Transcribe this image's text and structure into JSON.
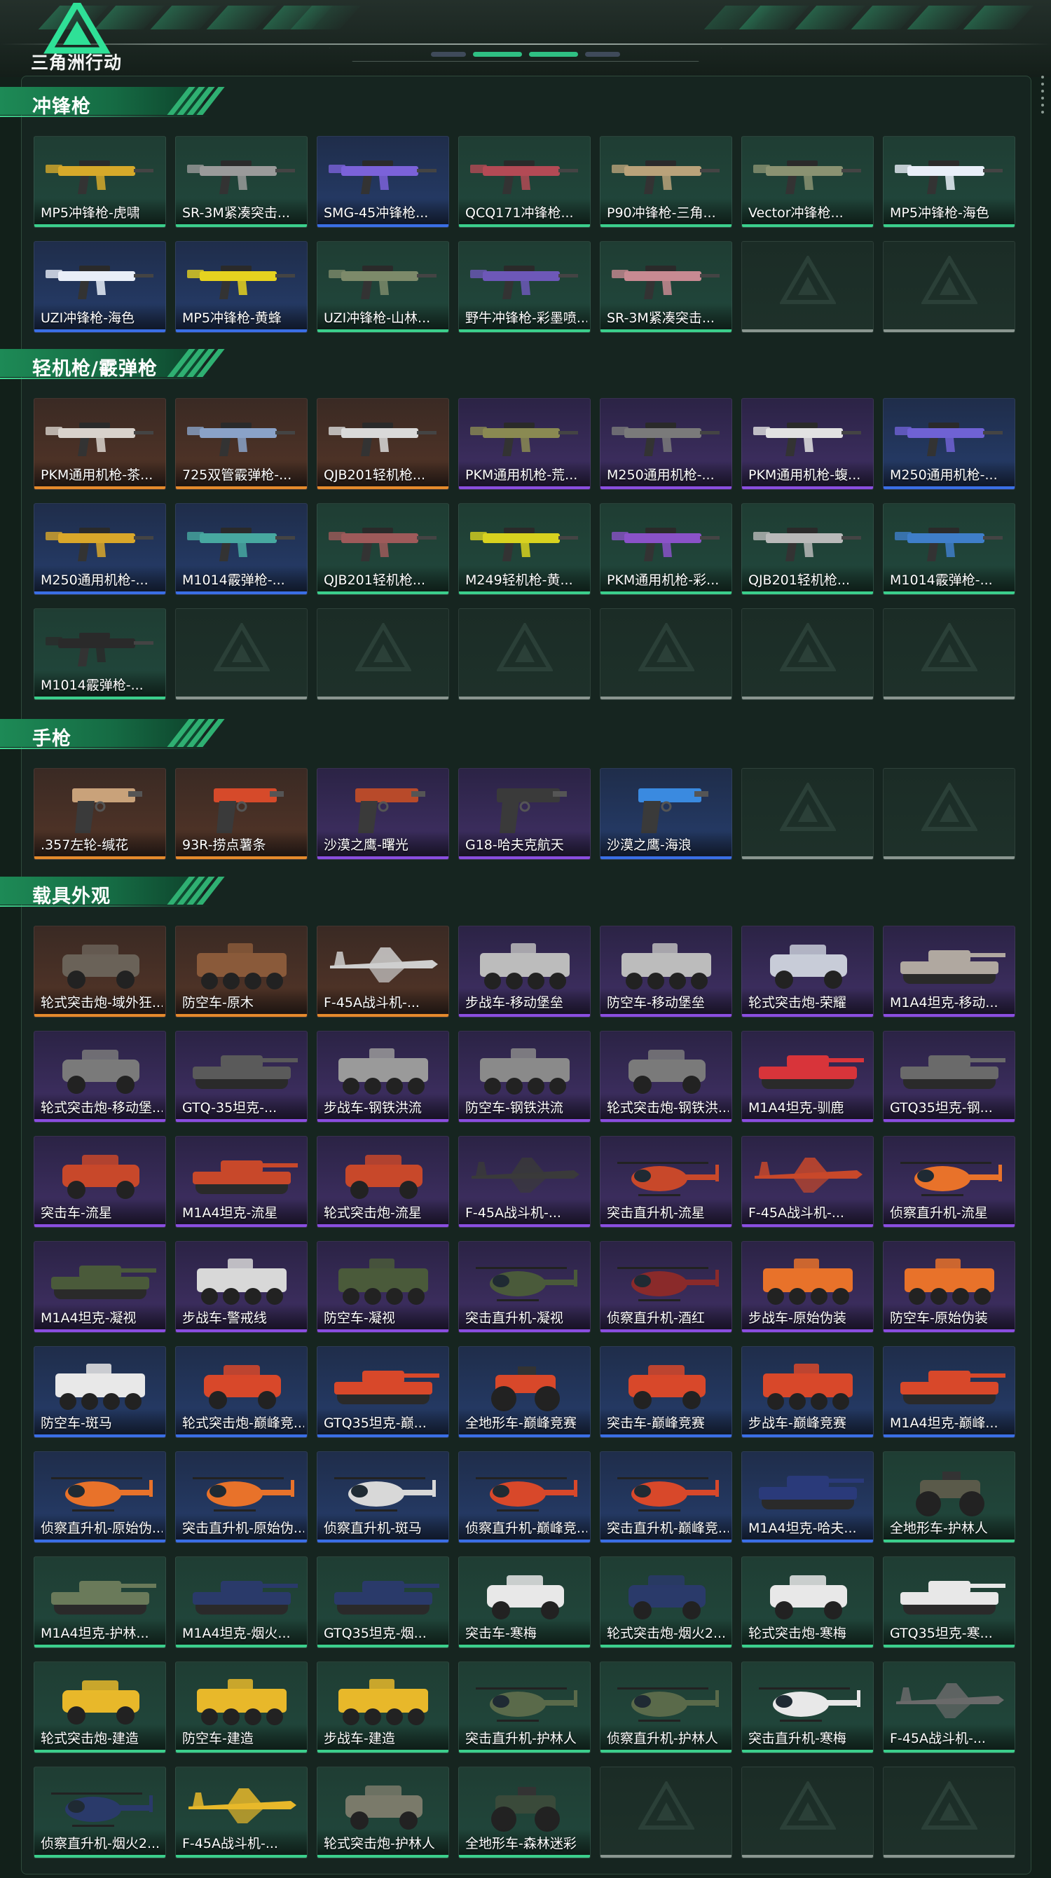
{
  "app": {
    "logo_text": "三角洲行动",
    "logo_icon": "delta-triangle-logo"
  },
  "colors": {
    "background": "#12201a",
    "accent_green": "#3bcf8c",
    "rarity_green": "#3bcf8c",
    "rarity_blue": "#3a6fe6",
    "rarity_purple": "#8a4ee0",
    "rarity_orange": "#e58a2c",
    "empty_slot": "#8a9690"
  },
  "sections": [
    {
      "title": "冲锋枪",
      "kind": "gun",
      "items": [
        {
          "name": "MP5冲锋枪-虎啸",
          "rarity": "green",
          "color": "#d6a92a"
        },
        {
          "name": "SR-3M紧凑突击...",
          "rarity": "green",
          "color": "#9a9a9a"
        },
        {
          "name": "SMG-45冲锋枪...",
          "rarity": "blue",
          "color": "#7b62d9"
        },
        {
          "name": "QCQ171冲锋枪...",
          "rarity": "green",
          "color": "#b34a55"
        },
        {
          "name": "P90冲锋枪-三角...",
          "rarity": "green",
          "color": "#b9a27a"
        },
        {
          "name": "Vector冲锋枪...",
          "rarity": "green",
          "color": "#8a9272"
        },
        {
          "name": "MP5冲锋枪-海色",
          "rarity": "green",
          "color": "#e8eef8"
        },
        {
          "name": "UZI冲锋枪-海色",
          "rarity": "blue",
          "color": "#e8eef8"
        },
        {
          "name": "MP5冲锋枪-黄蜂",
          "rarity": "blue",
          "color": "#e6d21f"
        },
        {
          "name": "UZI冲锋枪-山林...",
          "rarity": "green",
          "color": "#7d8a6a"
        },
        {
          "name": "野牛冲锋枪-彩墨喷...",
          "rarity": "green",
          "color": "#6d58b8"
        },
        {
          "name": "SR-3M紧凑突击...",
          "rarity": "green",
          "color": "#c88a92"
        },
        {
          "name": "",
          "rarity": "empty"
        },
        {
          "name": "",
          "rarity": "empty"
        }
      ]
    },
    {
      "title": "轻机枪/霰弹枪",
      "kind": "gun",
      "items": [
        {
          "name": "PKM通用机枪-茶...",
          "rarity": "orange",
          "color": "#d8d2cc"
        },
        {
          "name": "725双管霰弹枪-...",
          "rarity": "orange",
          "color": "#8aa2c8"
        },
        {
          "name": "QJB201轻机枪...",
          "rarity": "orange",
          "color": "#d9d9d9"
        },
        {
          "name": "PKM通用机枪-荒...",
          "rarity": "purple",
          "color": "#8a8a52"
        },
        {
          "name": "M250通用机枪-...",
          "rarity": "purple",
          "color": "#7a7a7a"
        },
        {
          "name": "PKM通用机枪-蝮...",
          "rarity": "purple",
          "color": "#e2e2e2"
        },
        {
          "name": "M250通用机枪-...",
          "rarity": "blue",
          "color": "#6f62d4"
        },
        {
          "name": "M250通用机枪-...",
          "rarity": "blue",
          "color": "#d9a72a"
        },
        {
          "name": "M1014霰弹枪-...",
          "rarity": "blue",
          "color": "#47a8a0"
        },
        {
          "name": "QJB201轻机枪...",
          "rarity": "green",
          "color": "#9e5a5a"
        },
        {
          "name": "M249轻机枪-黄...",
          "rarity": "green",
          "color": "#d8d21f"
        },
        {
          "name": "PKM通用机枪-彩...",
          "rarity": "green",
          "color": "#8a52c8"
        },
        {
          "name": "QJB201轻机枪...",
          "rarity": "green",
          "color": "#b9b9b9"
        },
        {
          "name": "M1014霰弹枪-...",
          "rarity": "green",
          "color": "#3f7ec9"
        },
        {
          "name": "M1014霰弹枪-...",
          "rarity": "green",
          "color": "#2a2a2a"
        },
        {
          "name": "",
          "rarity": "empty"
        },
        {
          "name": "",
          "rarity": "empty"
        },
        {
          "name": "",
          "rarity": "empty"
        },
        {
          "name": "",
          "rarity": "empty"
        },
        {
          "name": "",
          "rarity": "empty"
        },
        {
          "name": "",
          "rarity": "empty"
        }
      ]
    },
    {
      "title": "手枪",
      "kind": "pistol",
      "items": [
        {
          "name": ".357左轮-缄花",
          "rarity": "orange",
          "color": "#c9a27a"
        },
        {
          "name": "93R-捞点薯条",
          "rarity": "orange",
          "color": "#d64a2a"
        },
        {
          "name": "沙漠之鹰-曙光",
          "rarity": "purple",
          "color": "#b84a2a"
        },
        {
          "name": "G18-哈夫克航天",
          "rarity": "purple",
          "color": "#3a3a3a"
        },
        {
          "name": "沙漠之鹰-海浪",
          "rarity": "blue",
          "color": "#3a8ae0"
        },
        {
          "name": "",
          "rarity": "empty"
        },
        {
          "name": "",
          "rarity": "empty"
        }
      ]
    },
    {
      "title": "载具外观",
      "kind": "vehicle",
      "items": [
        {
          "name": "轮式突击炮-域外狂...",
          "rarity": "orange",
          "color": "#6a6258",
          "shape": "car"
        },
        {
          "name": "防空车-原木",
          "rarity": "orange",
          "color": "#8a5a3a",
          "shape": "apc"
        },
        {
          "name": "F-45A战斗机-...",
          "rarity": "orange",
          "color": "#cfcfcf",
          "shape": "jet"
        },
        {
          "name": "步战车-移动堡垒",
          "rarity": "purple",
          "color": "#bcbcbc",
          "shape": "apc"
        },
        {
          "name": "防空车-移动堡垒",
          "rarity": "purple",
          "color": "#bcbcbc",
          "shape": "apc"
        },
        {
          "name": "轮式突击炮-荣耀",
          "rarity": "purple",
          "color": "#c8ccd8",
          "shape": "car"
        },
        {
          "name": "M1A4坦克-移动...",
          "rarity": "purple",
          "color": "#b0a8a0",
          "shape": "tank"
        },
        {
          "name": "轮式突击炮-移动堡...",
          "rarity": "purple",
          "color": "#7a7a7a",
          "shape": "car"
        },
        {
          "name": "GTQ-35坦克-...",
          "rarity": "purple",
          "color": "#5a5a5a",
          "shape": "tank"
        },
        {
          "name": "步战车-钢铁洪流",
          "rarity": "purple",
          "color": "#9a9a9a",
          "shape": "apc"
        },
        {
          "name": "防空车-钢铁洪流",
          "rarity": "purple",
          "color": "#8a8a8a",
          "shape": "apc"
        },
        {
          "name": "轮式突击炮-钢铁洪...",
          "rarity": "purple",
          "color": "#7a7a7a",
          "shape": "car"
        },
        {
          "name": "M1A4坦克-驯鹿",
          "rarity": "purple",
          "color": "#d8343a",
          "shape": "tank"
        },
        {
          "name": "GTQ35坦克-钢...",
          "rarity": "purple",
          "color": "#6a6a6a",
          "shape": "tank"
        },
        {
          "name": "突击车-流星",
          "rarity": "purple",
          "color": "#c8482a",
          "shape": "car"
        },
        {
          "name": "M1A4坦克-流星",
          "rarity": "purple",
          "color": "#c8482a",
          "shape": "tank"
        },
        {
          "name": "轮式突击炮-流星",
          "rarity": "purple",
          "color": "#c8482a",
          "shape": "car"
        },
        {
          "name": "F-45A战斗机-...",
          "rarity": "purple",
          "color": "#3a3a3a",
          "shape": "jet"
        },
        {
          "name": "突击直升机-流星",
          "rarity": "purple",
          "color": "#c8482a",
          "shape": "heli"
        },
        {
          "name": "F-45A战斗机-...",
          "rarity": "purple",
          "color": "#c8482a",
          "shape": "jet"
        },
        {
          "name": "侦察直升机-流星",
          "rarity": "purple",
          "color": "#e8722a",
          "shape": "heli"
        },
        {
          "name": "M1A4坦克-凝视",
          "rarity": "purple",
          "color": "#4a5a3a",
          "shape": "tank"
        },
        {
          "name": "步战车-警戒线",
          "rarity": "purple",
          "color": "#d8d8d8",
          "shape": "apc"
        },
        {
          "name": "防空车-凝视",
          "rarity": "purple",
          "color": "#4a5a3a",
          "shape": "apc"
        },
        {
          "name": "突击直升机-凝视",
          "rarity": "purple",
          "color": "#4a5a3a",
          "shape": "heli"
        },
        {
          "name": "侦察直升机-酒红",
          "rarity": "purple",
          "color": "#8a2a2a",
          "shape": "heli"
        },
        {
          "name": "步战车-原始伪装",
          "rarity": "purple",
          "color": "#e8722a",
          "shape": "apc"
        },
        {
          "name": "防空车-原始伪装",
          "rarity": "purple",
          "color": "#e8722a",
          "shape": "apc"
        },
        {
          "name": "防空车-斑马",
          "rarity": "blue",
          "color": "#e8e8e8",
          "shape": "apc"
        },
        {
          "name": "轮式突击炮-巅峰竞...",
          "rarity": "blue",
          "color": "#d8482a",
          "shape": "car"
        },
        {
          "name": "GTQ35坦克-巅...",
          "rarity": "blue",
          "color": "#d8482a",
          "shape": "tank"
        },
        {
          "name": "全地形车-巅峰竞赛",
          "rarity": "blue",
          "color": "#d8482a",
          "shape": "atv"
        },
        {
          "name": "突击车-巅峰竞赛",
          "rarity": "blue",
          "color": "#d8482a",
          "shape": "car"
        },
        {
          "name": "步战车-巅峰竞赛",
          "rarity": "blue",
          "color": "#d8482a",
          "shape": "apc"
        },
        {
          "name": "M1A4坦克-巅峰...",
          "rarity": "blue",
          "color": "#d8482a",
          "shape": "tank"
        },
        {
          "name": "侦察直升机-原始伪...",
          "rarity": "blue",
          "color": "#e8722a",
          "shape": "heli"
        },
        {
          "name": "突击直升机-原始伪...",
          "rarity": "blue",
          "color": "#e8722a",
          "shape": "heli"
        },
        {
          "name": "侦察直升机-斑马",
          "rarity": "blue",
          "color": "#d8d8d8",
          "shape": "heli"
        },
        {
          "name": "侦察直升机-巅峰竞...",
          "rarity": "blue",
          "color": "#d8482a",
          "shape": "heli"
        },
        {
          "name": "突击直升机-巅峰竞...",
          "rarity": "blue",
          "color": "#d8482a",
          "shape": "heli"
        },
        {
          "name": "M1A4坦克-哈夫...",
          "rarity": "blue",
          "color": "#2a3a7a",
          "shape": "tank"
        },
        {
          "name": "全地形车-护林人",
          "rarity": "green",
          "color": "#5a5a4a",
          "shape": "atv"
        },
        {
          "name": "M1A4坦克-护林...",
          "rarity": "green",
          "color": "#6a7a5a",
          "shape": "tank"
        },
        {
          "name": "M1A4坦克-烟火...",
          "rarity": "green",
          "color": "#2a3a6a",
          "shape": "tank"
        },
        {
          "name": "GTQ35坦克-烟...",
          "rarity": "green",
          "color": "#2a3a6a",
          "shape": "tank"
        },
        {
          "name": "突击车-寒梅",
          "rarity": "green",
          "color": "#e8e8e8",
          "shape": "car"
        },
        {
          "name": "轮式突击炮-烟火2...",
          "rarity": "green",
          "color": "#2a3a6a",
          "shape": "car"
        },
        {
          "name": "轮式突击炮-寒梅",
          "rarity": "green",
          "color": "#e8e8e8",
          "shape": "car"
        },
        {
          "name": "GTQ35坦克-寒...",
          "rarity": "green",
          "color": "#e8e8e8",
          "shape": "tank"
        },
        {
          "name": "轮式突击炮-建造",
          "rarity": "green",
          "color": "#e8b82a",
          "shape": "car"
        },
        {
          "name": "防空车-建造",
          "rarity": "green",
          "color": "#e8b82a",
          "shape": "apc"
        },
        {
          "name": "步战车-建造",
          "rarity": "green",
          "color": "#e8b82a",
          "shape": "apc"
        },
        {
          "name": "突击直升机-护林人",
          "rarity": "green",
          "color": "#5a6a4a",
          "shape": "heli"
        },
        {
          "name": "侦察直升机-护林人",
          "rarity": "green",
          "color": "#5a6a4a",
          "shape": "heli"
        },
        {
          "name": "突击直升机-寒梅",
          "rarity": "green",
          "color": "#e8e8e8",
          "shape": "heli"
        },
        {
          "name": "F-45A战斗机-...",
          "rarity": "green",
          "color": "#6a6a6a",
          "shape": "jet"
        },
        {
          "name": "侦察直升机-烟火2...",
          "rarity": "green",
          "color": "#2a3a6a",
          "shape": "heli"
        },
        {
          "name": "F-45A战斗机-...",
          "rarity": "green",
          "color": "#e8b82a",
          "shape": "jet"
        },
        {
          "name": "轮式突击炮-护林人",
          "rarity": "green",
          "color": "#7a7a6a",
          "shape": "car"
        },
        {
          "name": "全地形车-森林迷彩",
          "rarity": "green",
          "color": "#3a4a3a",
          "shape": "atv"
        },
        {
          "name": "",
          "rarity": "empty"
        },
        {
          "name": "",
          "rarity": "empty"
        },
        {
          "name": "",
          "rarity": "empty"
        }
      ]
    }
  ]
}
